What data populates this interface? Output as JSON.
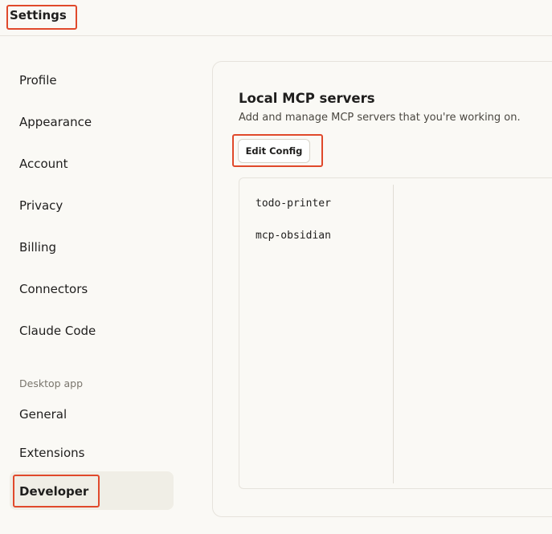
{
  "header": {
    "title": "Settings"
  },
  "sidebar": {
    "items": [
      {
        "label": "Profile"
      },
      {
        "label": "Appearance"
      },
      {
        "label": "Account"
      },
      {
        "label": "Privacy"
      },
      {
        "label": "Billing"
      },
      {
        "label": "Connectors"
      },
      {
        "label": "Claude Code"
      }
    ],
    "section_label": "Desktop app",
    "desktop_items": [
      {
        "label": "General"
      },
      {
        "label": "Extensions"
      },
      {
        "label": "Developer",
        "active": true
      }
    ]
  },
  "main": {
    "title": "Local MCP servers",
    "subtitle": "Add and manage MCP servers that you're working on.",
    "edit_config_label": "Edit Config",
    "servers": [
      {
        "name": "todo-printer"
      },
      {
        "name": "mcp-obsidian"
      }
    ]
  },
  "colors": {
    "background": "#faf9f5",
    "active_nav": "#f0eee6",
    "highlight": "#e0492b"
  }
}
